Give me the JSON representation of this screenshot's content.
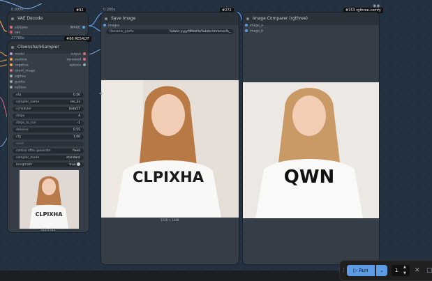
{
  "nodes": {
    "vae_decode": {
      "time": "0.000s",
      "title": "VAE Decode",
      "badge": "#92",
      "inputs": [
        "samples",
        "vae"
      ],
      "output": "IMAGE"
    },
    "clownshark": {
      "time": "27790s",
      "badge": "#86 RES4LYF",
      "title": "ClownsharkSampler",
      "inputs": [
        "model",
        "positive",
        "negative",
        "latent_image",
        "sigmas",
        "guides",
        "options"
      ],
      "outputs": [
        "output",
        "denoised",
        "options"
      ],
      "widgets": [
        {
          "label": "eta",
          "value": "0.50"
        },
        {
          "label": "sampler_name",
          "value": "res_2s"
        },
        {
          "label": "scheduler",
          "value": "beta57"
        },
        {
          "label": "steps",
          "value": "4"
        },
        {
          "label": "steps_to_run",
          "value": "-1"
        },
        {
          "label": "denoise",
          "value": "0.55"
        },
        {
          "label": "cfg",
          "value": "1.00"
        },
        {
          "label": "seed",
          "value": ""
        },
        {
          "label": "control after generate",
          "value": "fixed"
        },
        {
          "label": "sampler_mode",
          "value": "standard"
        },
        {
          "label": "bongmath",
          "value": "true"
        }
      ],
      "preview_caption": "512 x 512"
    },
    "save_image": {
      "time": "0.280s",
      "badge": "#272",
      "title": "Save Image",
      "input": "images",
      "widget_label": "filename_prefix",
      "widget_value": "%date:yyyyMMdd%/%date:hhmmss%_",
      "caption": "1248 × 1248",
      "shirt_text": "CLPIXHA"
    },
    "image_compare": {
      "badge": "#153 rgthree-comfy",
      "title": "Image Comparer (rgthree)",
      "inputs": [
        "image_a",
        "image_b"
      ],
      "shirt_text": "QWN"
    }
  },
  "run_bar": {
    "run_label": "Run",
    "caret": "⌄",
    "count": "1"
  },
  "colors": {
    "canvas": "#233040",
    "node": "#353d46",
    "accent": "#5d9ce5"
  }
}
